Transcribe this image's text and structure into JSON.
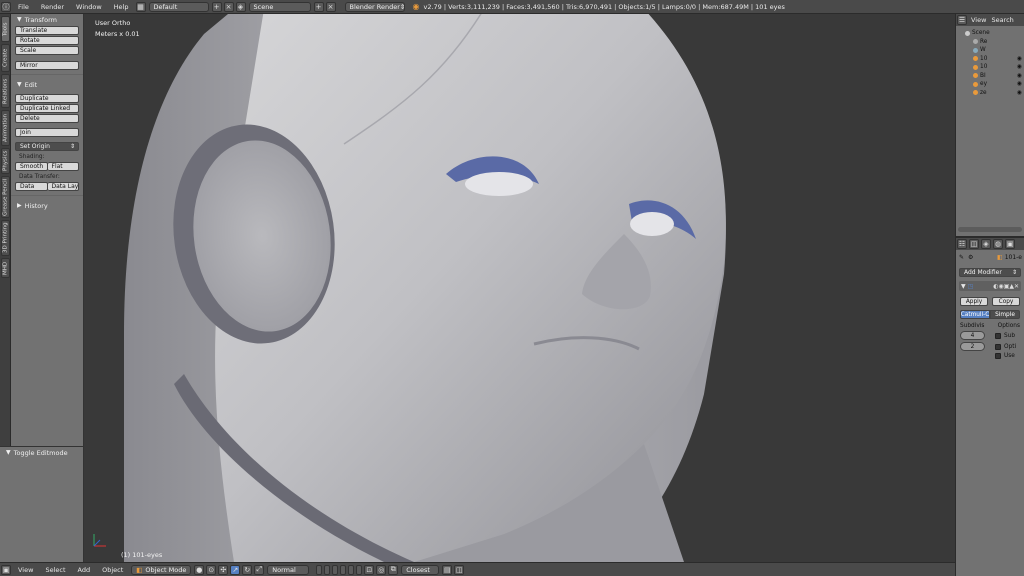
{
  "topbar": {
    "menus": [
      "File",
      "Render",
      "Window",
      "Help"
    ],
    "layout": "Default",
    "scene": "Scene",
    "engine": "Blender Render",
    "stats": "v2.79 | Verts:3,111,239 | Faces:3,491,560 | Tris:6,970,491 | Objects:1/5 | Lamps:0/0 | Mem:687.49M | 101 eyes"
  },
  "tool_tabs": [
    "Tools",
    "Create",
    "Relations",
    "Animation",
    "Physics",
    "Grease Pencil",
    "3D Printing",
    "MHD"
  ],
  "tool_shelf": {
    "transform": {
      "title": "Transform",
      "buttons": [
        "Translate",
        "Rotate",
        "Scale",
        "Mirror"
      ]
    },
    "edit": {
      "title": "Edit",
      "buttons": [
        "Duplicate",
        "Duplicate Linked",
        "Delete",
        "Join"
      ],
      "set_origin": "Set Origin",
      "shading_label": "Shading:",
      "smooth": "Smooth",
      "flat": "Flat",
      "data_transfer_label": "Data Transfer:",
      "data": "Data",
      "data_layo": "Data Layo"
    },
    "history": "History"
  },
  "operator_panel": {
    "title": "Toggle Editmode"
  },
  "viewport": {
    "view_name": "User Ortho",
    "scale": "Meters x 0.01",
    "object_label": "(1) 101-eyes"
  },
  "bottombar": {
    "menus": [
      "View",
      "Select",
      "Add",
      "Object"
    ],
    "mode": "Object Mode",
    "orientation": "Normal",
    "snap": "Closest"
  },
  "outliner": {
    "menus": [
      "View",
      "Search"
    ],
    "rows": [
      "Scene",
      "Re",
      "W",
      "10",
      "10",
      "BI",
      "ey",
      "ze"
    ]
  },
  "properties": {
    "object_name": "101-e",
    "add_modifier": "Add Modifier",
    "apply": "Apply",
    "copy": "Copy",
    "catmull": "Catmull-C",
    "simple": "Simple",
    "subdivis_label": "Subdivis",
    "options_label": "Options",
    "view_levels": "4",
    "render_levels": "2",
    "opt1": "Sub",
    "opt2": "Opti",
    "opt3": "Use"
  },
  "colors": {
    "header": "#4a4a4a",
    "panel": "#727272",
    "viewport_bg": "#393939",
    "accent_blue": "#5680c2"
  }
}
